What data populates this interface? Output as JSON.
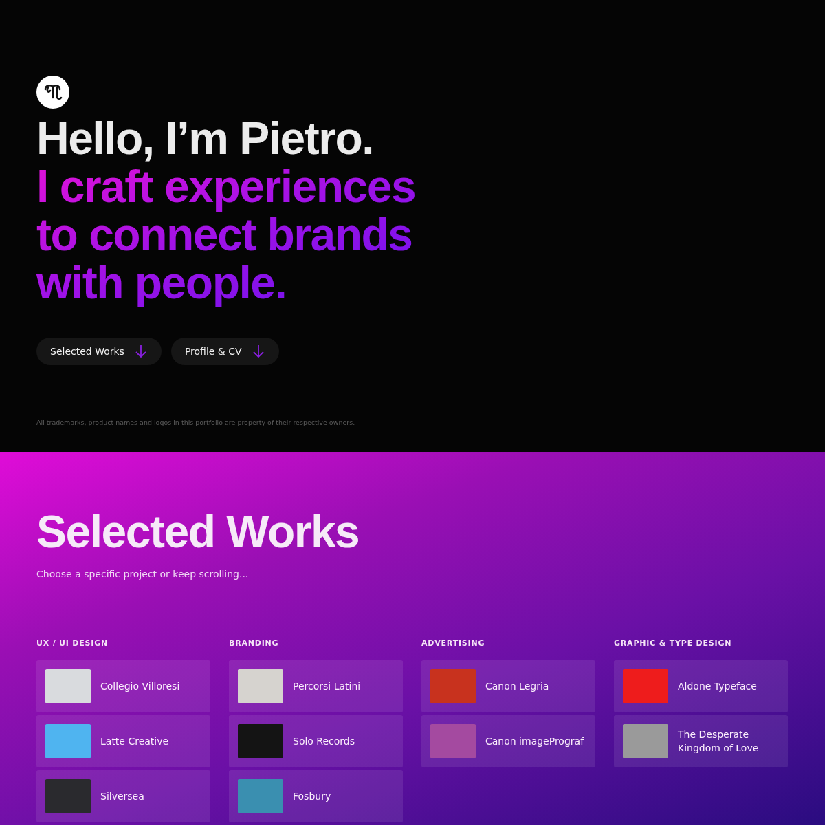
{
  "hero": {
    "greeting": "Hello, I’m Pietro.",
    "tagline_lines": [
      "I craft experiences",
      "to connect brands",
      "with people."
    ],
    "buttons": [
      {
        "label": "Selected Works"
      },
      {
        "label": "Profile & CV"
      }
    ],
    "disclaimer": "All trademarks, product names and logos in this portfolio are property of their respective owners."
  },
  "works": {
    "title": "Selected Works",
    "subtitle": "Choose a specific project or keep scrolling...",
    "categories": [
      {
        "heading": "UX / UI DESIGN",
        "projects": [
          {
            "name": "Collegio Villoresi",
            "color": "#d9dbde"
          },
          {
            "name": "Latte Creative",
            "color": "#4fb4f0"
          },
          {
            "name": "Silversea",
            "color": "#2a2a2e"
          }
        ]
      },
      {
        "heading": "BRANDING",
        "projects": [
          {
            "name": "Percorsi Latini",
            "color": "#d6d3cf"
          },
          {
            "name": "Solo Records",
            "color": "#141414"
          },
          {
            "name": "Fosbury",
            "color": "#3a8fb0"
          }
        ]
      },
      {
        "heading": "ADVERTISING",
        "projects": [
          {
            "name": "Canon Legria",
            "color": "#c8321e"
          },
          {
            "name": "Canon imagePrograf",
            "color": "#a44aa0"
          }
        ]
      },
      {
        "heading": "GRAPHIC & TYPE DESIGN",
        "projects": [
          {
            "name": "Aldone Typeface",
            "color": "#ee1c1c"
          },
          {
            "name": "The Desperate Kingdom of Love",
            "color": "#9a9a9a"
          }
        ]
      }
    ]
  }
}
